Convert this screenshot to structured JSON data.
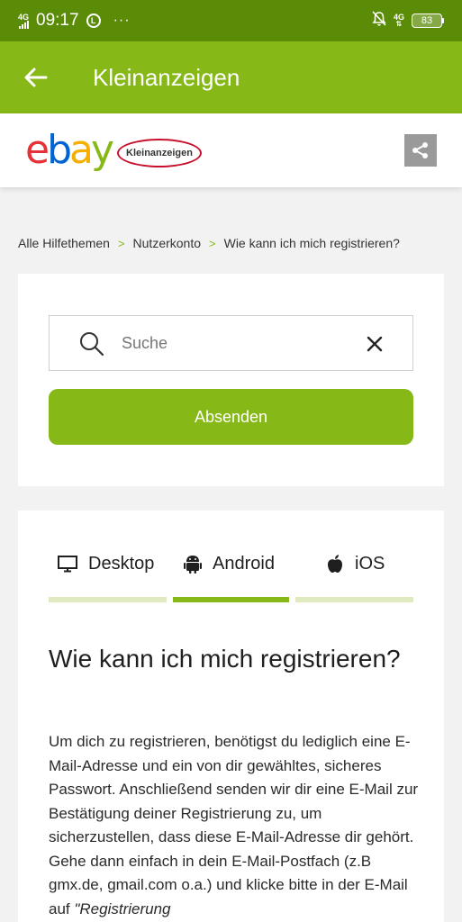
{
  "status_bar": {
    "network": "4G",
    "time": "09:17",
    "circle_icon_text": "Ⓛ",
    "dots": "···",
    "network_right": "4G",
    "battery": "83"
  },
  "app_bar": {
    "title": "Kleinanzeigen"
  },
  "brand": {
    "logo_letters": [
      "e",
      "b",
      "a",
      "y"
    ],
    "logo_colors": [
      "#e53238",
      "#0064d2",
      "#f5af02",
      "#86b817"
    ],
    "badge_text": "Kleinanzeigen"
  },
  "breadcrumb": {
    "items": [
      "Alle Hilfethemen",
      "Nutzerkonto",
      "Wie kann ich mich registrieren?"
    ],
    "separator": ">"
  },
  "search": {
    "placeholder": "Suche",
    "value": "",
    "submit_label": "Absenden"
  },
  "tabs": [
    {
      "label": "Desktop",
      "icon": "desktop-icon",
      "selected": false
    },
    {
      "label": "Android",
      "icon": "android-icon",
      "selected": true
    },
    {
      "label": "iOS",
      "icon": "apple-icon",
      "selected": false
    }
  ],
  "article": {
    "title": "Wie kann ich mich registrieren?",
    "body": "Um dich zu registrieren, benötigst du lediglich eine E-Mail-Adresse und ein von dir gewähltes, sicheres Passwort. Anschließend senden wir dir eine E-Mail zur Bestätigung deiner Registrierung zu, um sicherzustellen, dass diese E-Mail-Adresse dir gehört. Gehe dann einfach in dein E-Mail-Postfach (z.B gmx.de, gmail.com o.a.) und klicke bitte in der E-Mail auf",
    "body_italic": "\"Registrierung"
  },
  "colors": {
    "status_bar": "#5b8c08",
    "brand_green": "#86b817",
    "tab_inactive": "#dfeac0"
  }
}
